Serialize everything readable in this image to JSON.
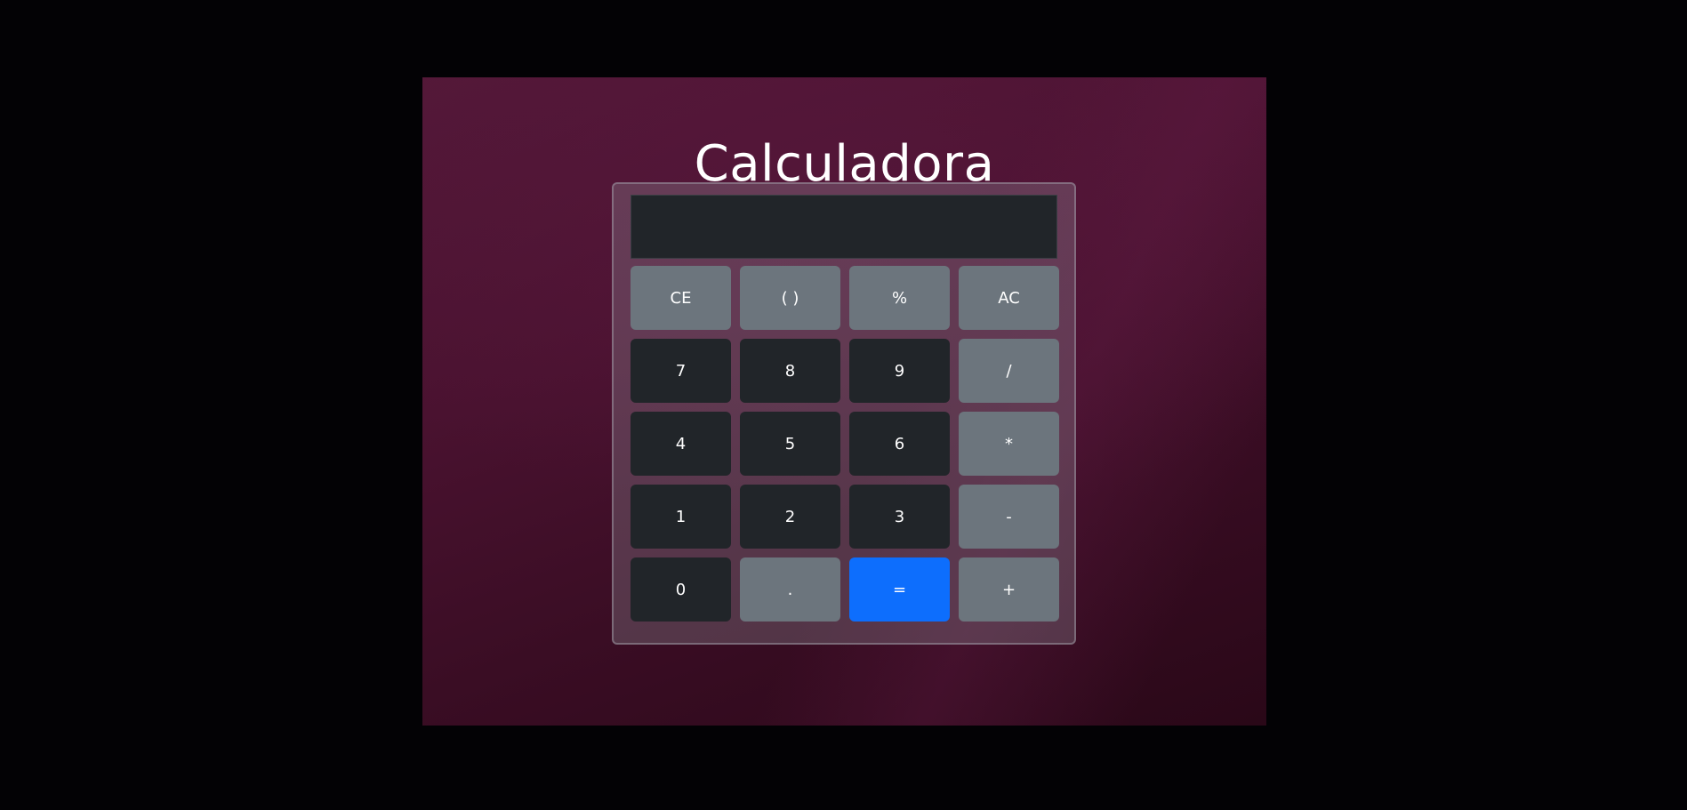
{
  "page": {
    "title": "Calculadora"
  },
  "display": {
    "value": ""
  },
  "keys": [
    {
      "label": "CE",
      "style": "secondary"
    },
    {
      "label": "( )",
      "style": "secondary"
    },
    {
      "label": "%",
      "style": "secondary"
    },
    {
      "label": "AC",
      "style": "secondary"
    },
    {
      "label": "7",
      "style": "dark"
    },
    {
      "label": "8",
      "style": "dark"
    },
    {
      "label": "9",
      "style": "dark"
    },
    {
      "label": "/",
      "style": "secondary"
    },
    {
      "label": "4",
      "style": "dark"
    },
    {
      "label": "5",
      "style": "dark"
    },
    {
      "label": "6",
      "style": "dark"
    },
    {
      "label": "*",
      "style": "secondary"
    },
    {
      "label": "1",
      "style": "dark"
    },
    {
      "label": "2",
      "style": "dark"
    },
    {
      "label": "3",
      "style": "dark"
    },
    {
      "label": "-",
      "style": "secondary"
    },
    {
      "label": "0",
      "style": "dark"
    },
    {
      "label": ".",
      "style": "secondary"
    },
    {
      "label": "=",
      "style": "primary"
    },
    {
      "label": "+",
      "style": "secondary"
    }
  ],
  "colors": {
    "secondary": "#6c757d",
    "dark": "#212529",
    "primary": "#0d6efd"
  }
}
